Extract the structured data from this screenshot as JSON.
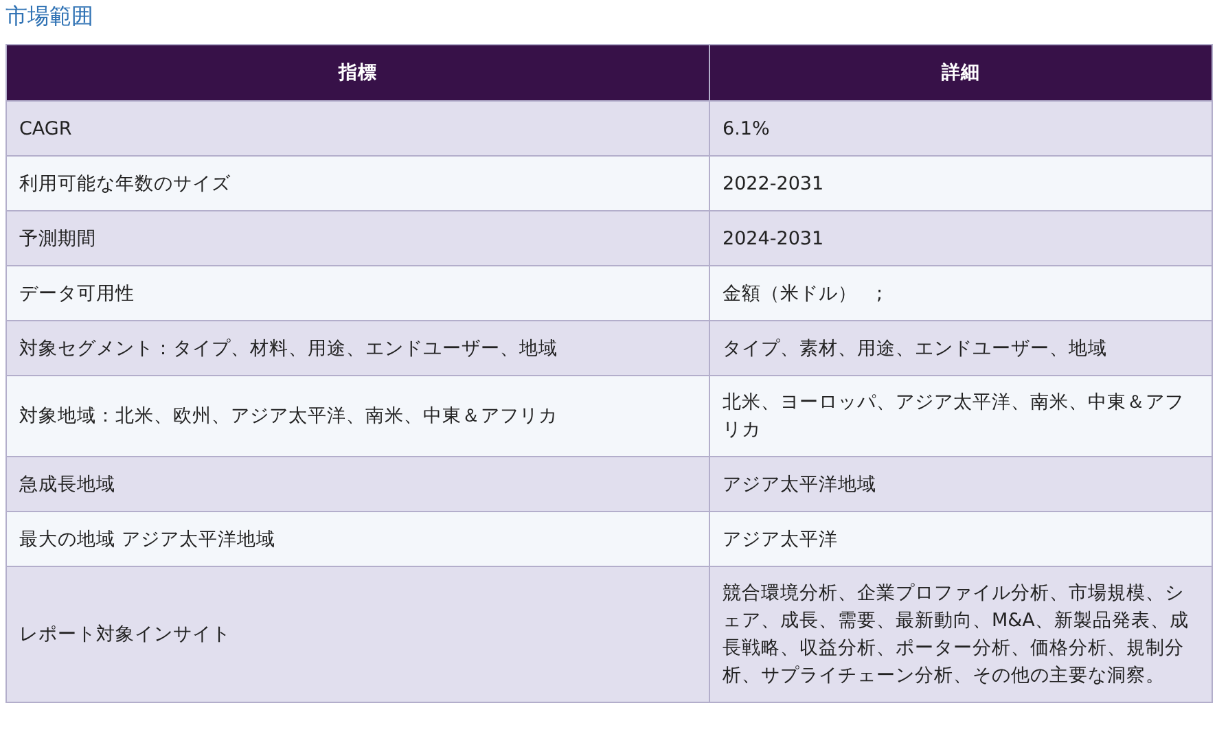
{
  "title": "市場範囲",
  "table": {
    "columns": [
      "指標",
      "詳細"
    ],
    "rows": [
      {
        "metric": "CAGR",
        "detail": "6.1%"
      },
      {
        "metric": "利用可能な年数のサイズ",
        "detail": "2022-2031"
      },
      {
        "metric": "予測期間",
        "detail": "2024-2031"
      },
      {
        "metric": "データ可用性",
        "detail": "金額（米ドル）　;"
      },
      {
        "metric": "対象セグメント：タイプ、材料、用途、エンドユーザー、地域",
        "detail": "タイプ、素材、用途、エンドユーザー、地域"
      },
      {
        "metric": "対象地域：北米、欧州、アジア太平洋、南米、中東＆アフリカ",
        "detail": "北米、ヨーロッパ、アジア太平洋、南米、中東＆アフリカ"
      },
      {
        "metric": "急成長地域",
        "detail": "アジア太平洋地域"
      },
      {
        "metric": "最大の地域 アジア太平洋地域",
        "detail": "アジア太平洋"
      },
      {
        "metric": "レポート対象インサイト",
        "detail": "競合環境分析、企業プロファイル分析、市場規模、シェア、成長、需要、最新動向、M&A、新製品発表、成長戦略、収益分析、ポーター分析、価格分析、規制分析、サプライチェーン分析、その他の主要な洞察。"
      }
    ]
  }
}
